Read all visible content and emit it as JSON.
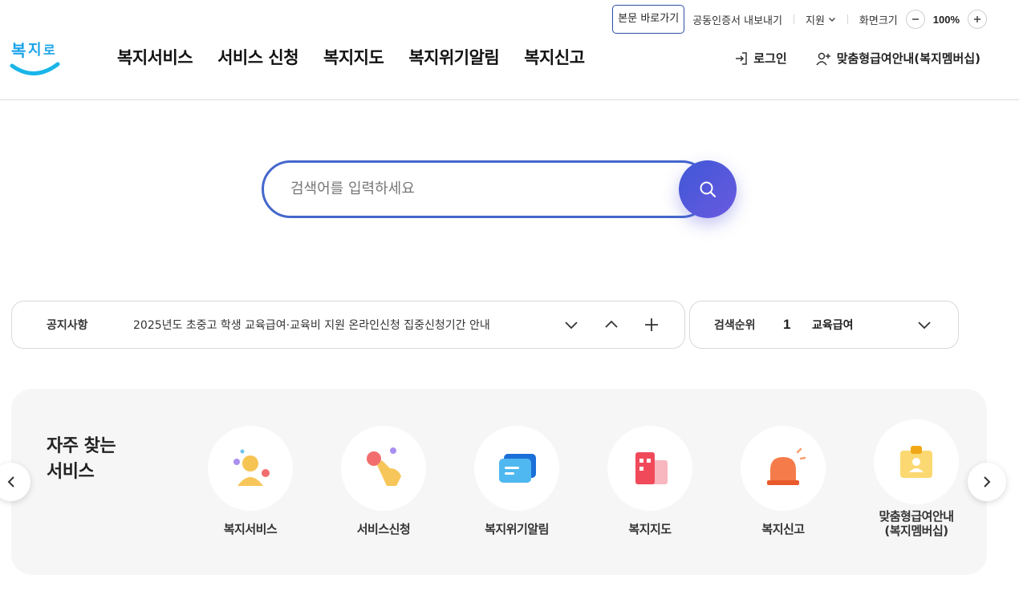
{
  "utility": {
    "skip_link": "본문 바로가기",
    "cert_export": "공동인증서 내보내기",
    "support": "지원",
    "zoom_label": "화면크기",
    "zoom_value": "100%"
  },
  "header": {
    "logo_text": "복지로",
    "nav": [
      "복지서비스",
      "서비스 신청",
      "복지지도",
      "복지위기알림",
      "복지신고"
    ],
    "login": "로그인",
    "membership": "맞춤형급여안내(복지멤버십)"
  },
  "search": {
    "placeholder": "검색어를 입력하세요"
  },
  "notice": {
    "label": "공지사항",
    "text": "2025년도 초중고 학생 교육급여·교육비 지원 온라인신청 집중신청기간 안내"
  },
  "ranking": {
    "label": "검색순위",
    "rank": "1",
    "keyword": "교육급여"
  },
  "frequent": {
    "title_line1": "자주 찾는",
    "title_line2": "서비스",
    "items": [
      {
        "label": "복지서비스",
        "icon": "person-icon"
      },
      {
        "label": "서비스신청",
        "icon": "hand-tap-icon"
      },
      {
        "label": "복지위기알림",
        "icon": "chat-bubble-icon"
      },
      {
        "label": "복지지도",
        "icon": "building-map-icon"
      },
      {
        "label": "복지신고",
        "icon": "siren-icon"
      },
      {
        "label": "맞춤형급여안내\n(복지멤버십)",
        "label1": "맞춤형급여안내",
        "label2": "(복지멤버십)",
        "icon": "id-card-icon"
      }
    ]
  },
  "colors": {
    "accent": "#4467cc",
    "search_button": "#5a56dc",
    "logo_blue": "#1aa3e8"
  }
}
